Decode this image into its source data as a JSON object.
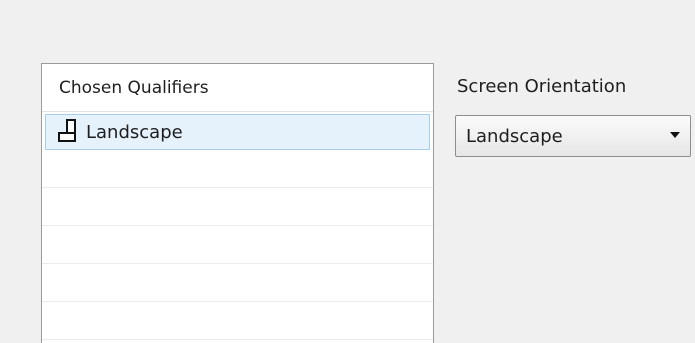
{
  "qualifiers_list": {
    "header": "Chosen Qualifiers",
    "items": [
      {
        "label": "Landscape",
        "icon": "landscape-orientation-icon",
        "selected": true
      }
    ]
  },
  "orientation": {
    "label": "Screen Orientation",
    "value": "Landscape"
  }
}
